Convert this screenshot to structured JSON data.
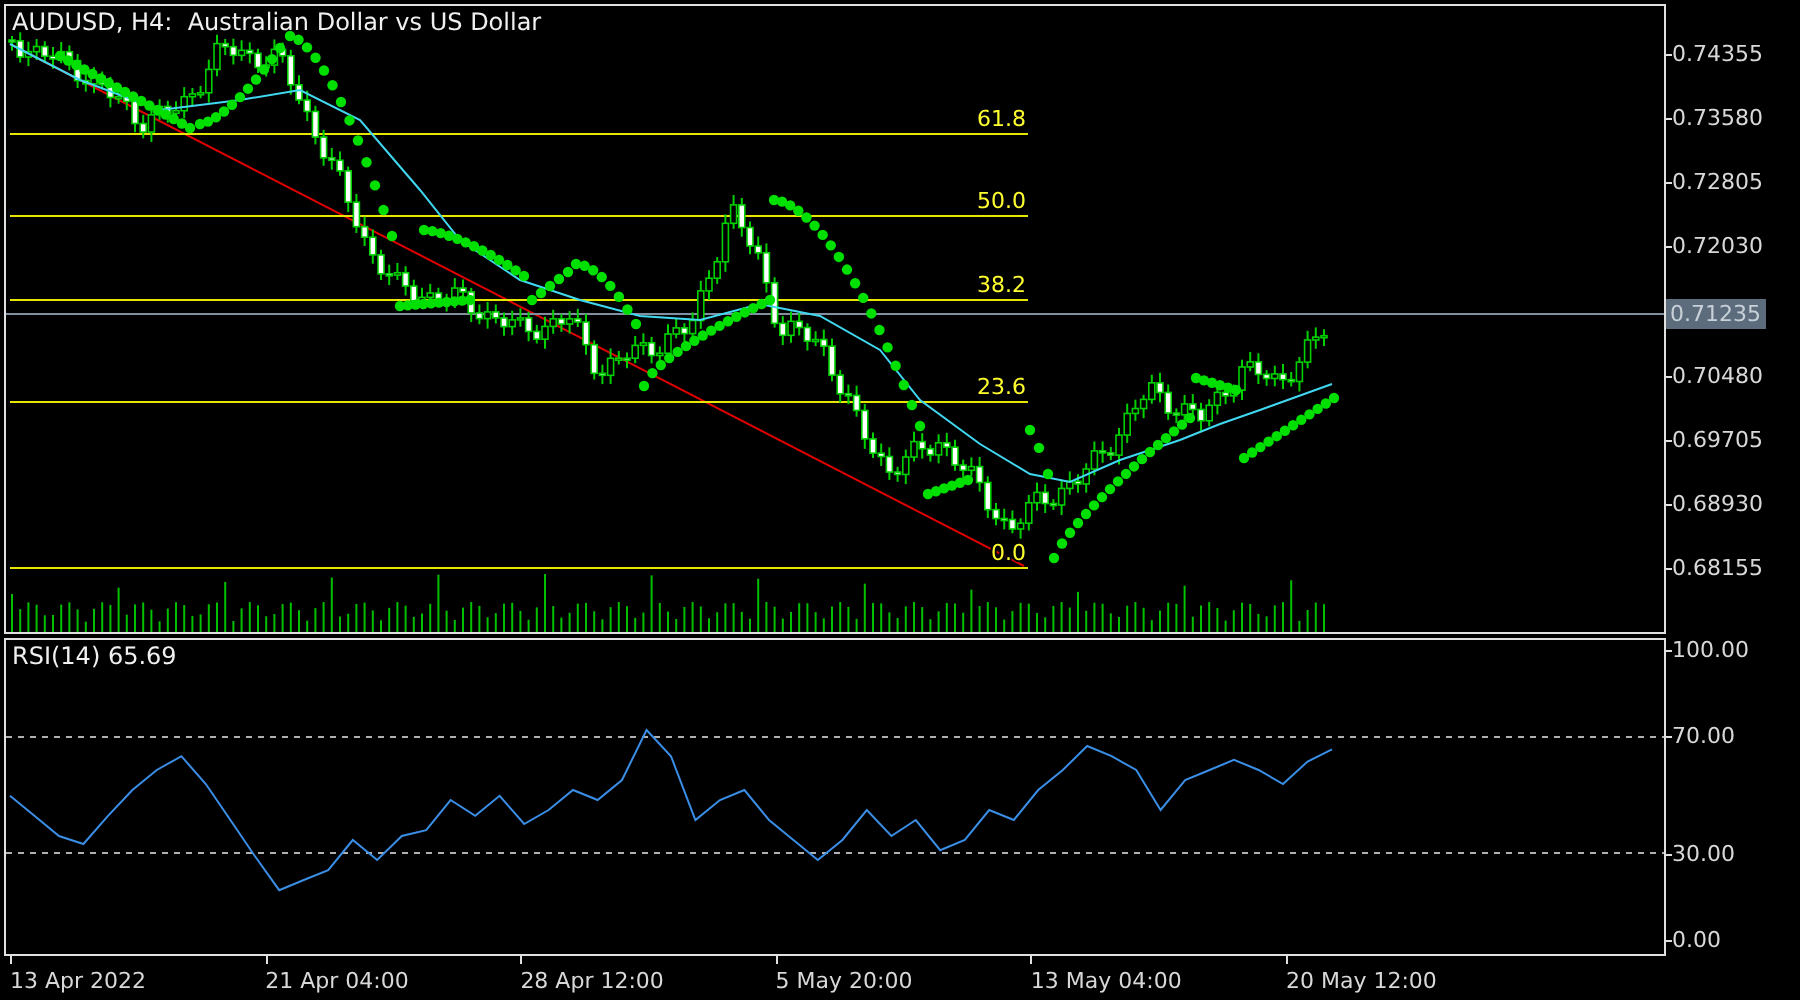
{
  "main_chart": {
    "title": "AUDUSD, H4:  Australian Dollar vs US Dollar",
    "fibonacci_levels": [
      "61.8",
      "50.0",
      "38.2",
      "23.6",
      "0.0"
    ],
    "price_axis": {
      "labels": [
        "0.74355",
        "0.73580",
        "0.72805",
        "0.72030",
        "0.70480",
        "0.69705",
        "0.68930",
        "0.68155"
      ],
      "current_price": "0.71235"
    }
  },
  "rsi_panel": {
    "title": "RSI(14) 65.69",
    "chart_data": {
      "type": "line",
      "ylim": [
        -5.5,
        105.5
      ],
      "yticks": [
        {
          "value": 100,
          "label": "100.00"
        },
        {
          "value": 70,
          "label": "70.00"
        },
        {
          "value": 30,
          "label": "30.00"
        },
        {
          "value": 0,
          "label": "0.00"
        }
      ],
      "series": [
        {
          "color": "#3a8ee6",
          "values": [
            49.7,
            42.8,
            35.9,
            33.1,
            42.8,
            51.7,
            58.6,
            63.4,
            53.8,
            41.4,
            29.0,
            17.2,
            20.7,
            24.1,
            34.5,
            27.6,
            35.9,
            37.9,
            48.3,
            42.8,
            49.7,
            40.0,
            44.8,
            51.7,
            48.3,
            55.2,
            72.4,
            63.4,
            41.4,
            48.3,
            51.7,
            41.4,
            34.5,
            27.6,
            34.5,
            44.8,
            35.9,
            41.4,
            31.0,
            34.5,
            44.8,
            41.4,
            51.7,
            58.6,
            66.9,
            63.4,
            58.6,
            44.8,
            55.2,
            58.6,
            62.1,
            58.6,
            53.8,
            61.5,
            65.7
          ]
        }
      ]
    }
  },
  "time_axis": {
    "labels": [
      "13 Apr 2022",
      "21 Apr 04:00",
      "28 Apr 12:00",
      "5 May 20:00",
      "13 May 04:00",
      "20 May 12:00"
    ]
  }
}
